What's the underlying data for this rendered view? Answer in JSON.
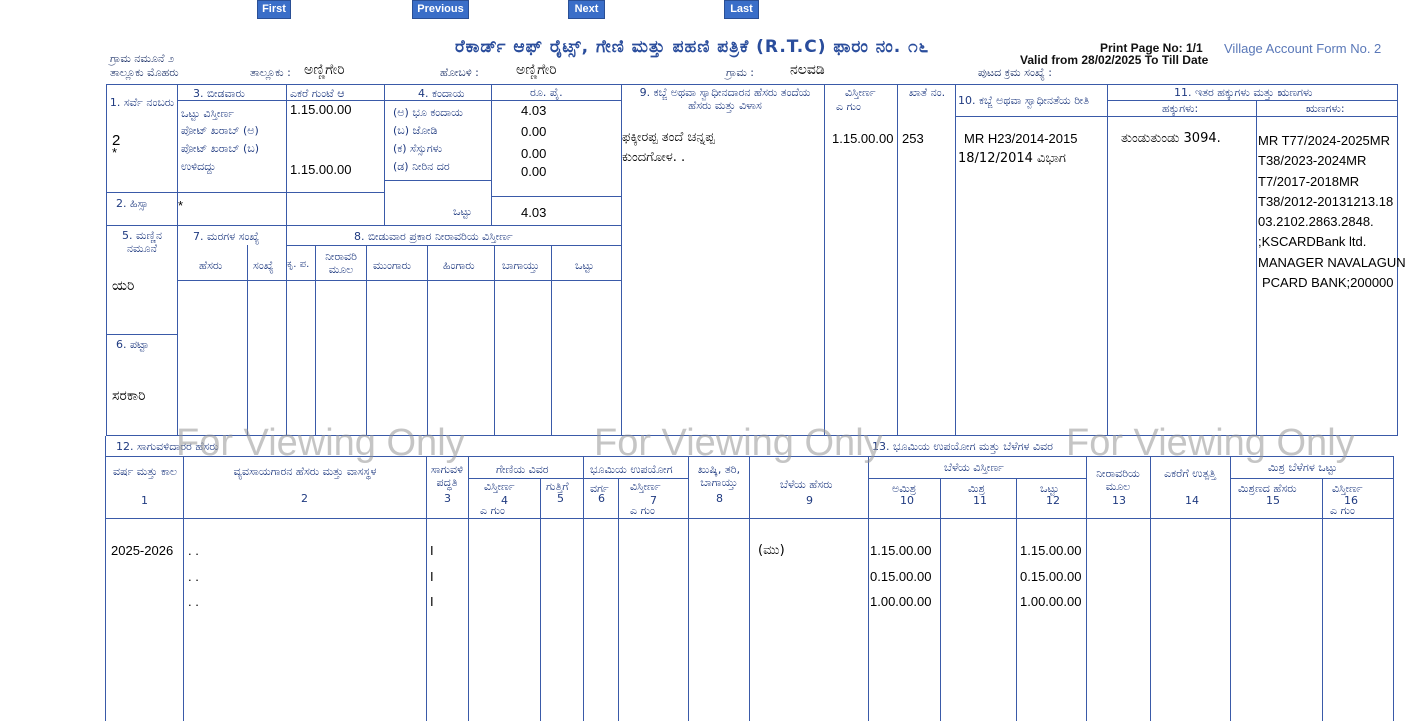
{
  "nav": {
    "first": "First",
    "previous": "Previous",
    "next": "Next",
    "last": "Last"
  },
  "header": {
    "title": "ರೆಕಾರ್ಡ್ ಆಫ್ ರೈಟ್ಸ್, ಗೇಣಿ ಮತ್ತು ಪಹಣಿ ಪತ್ರಿಕೆ (R.T.C) ಫಾರಂ ನಂ. ೧೬",
    "print_page": "Print Page No: 1/1",
    "form_name": "Village Account Form No. 2",
    "valid_from": "Valid from 28/02/2025 To Till Date",
    "form_label": "ಗ್ರಾಮ ನಮೂನೆ ೨",
    "taluk_seal_label": "ತಾಲ್ಲೂಕು ಮೊಹರು",
    "taluk_label": "ತಾಲ್ಲೂಕು :",
    "taluk": "ಅಣ್ಣಿಗೇರಿ",
    "hobli_label": "ಹೋಬಳಿ :",
    "hobli": "ಅಣ್ಣಿಗೇರಿ",
    "village_label": "ಗ್ರಾಮ :",
    "village": "ನಲವಡಿ",
    "page_serial_label": "ಪುಟದ ಕ್ರಮ ಸಂಖ್ಯೆ :"
  },
  "survey": {
    "survey_no_label": "1. ಸರ್ವೆ ನಂಬರು",
    "survey_no": "2",
    "star": "*",
    "hissa_label": "2. ಹಿಸ್ಸಾ",
    "hissa": "*",
    "cultivated_label": "3. ಬೀಡವಾರು",
    "ekare_header": "ಎಕರೆ   ಗುಂಟೆ   ಆ",
    "total_area_label": "ಒಟ್ಟು ವಿಸ್ತೀರ್ಣ",
    "pot_a_label": "ಪೋಟ್ ಖರಾಬ್ (ಅ)",
    "pot_b_label": "ಪೋಟ್ ಖರಾಬ್ (ಬ)",
    "remaining_label": "ಉಳಿದದ್ದು",
    "total_area": "1.15.00.00",
    "remaining": "1.15.00.00",
    "revenue_label": "4. ಕಂದಾಯ",
    "rs_label": "ರೂ.          ಪೈ.",
    "land_rev_label": "(ಅ) ಭೂ ಕಂದಾಯ",
    "jodi_label": "(ಬ) ಜೋಡಿ",
    "cess_label": "(ಕ) ಸೆಸ್ಸುಗಳು",
    "water_label": "(ಡ) ನೀರಿನ ದರ",
    "land_rev": "4.03",
    "jodi": "0.00",
    "cess": "0.00",
    "water": "0.00",
    "total_label": "ಒಟ್ಟು",
    "total": "4.03",
    "soil_label": "5. ಮಣ್ಣಿನ ನಮೂನೆ",
    "soil": "ಯರಿ",
    "tree_label": "7. ಮರಗಳ ಸಂಖ್ಯೆ",
    "tree_name": "ಹೆಸರು",
    "tree_count": "ಸಂಖ್ಯೆ",
    "kp": "ಕೃ. ಪ.",
    "irrig_label": "8. ಬೀಡುವಾರ ಪ್ರಕಾರ ನೀರಾವರಿಯ ವಿಸ್ತೀರ್ಣ",
    "irrig_source": "ನೀರಾವರಿ ಮೂಲ",
    "mungaru": "ಮುಂಗಾರು",
    "hingaru": "ಹಿಂಗಾರು",
    "bagayat": "ಬಾಗಾಯ್ತು",
    "ottu": "ಒಟ್ಟು",
    "patta_label": "6. ಪಟ್ಟಾ",
    "patta": "ಸರಕಾರಿ"
  },
  "owner": {
    "owner_header": "9. ಕಬ್ಜೆ ಅಥವಾ ಸ್ವಾಧೀನದಾರನ ಹೆಸರು ತಂದೆಯ ಹೆಸರು ಮತ್ತು ವಿಳಾಸ",
    "area_header": "ವಿಸ್ತೀರ್ಣ",
    "area_units": "ಎ         ಗುಂ",
    "khata_header": "ಖಾತೆ ನಂ.",
    "mutation_header": "10. ಕಬ್ಜೆ ಅಥವಾ ಸ್ವಾಧೀನತೆಯ ರೀತಿ",
    "rights_header": "11. ಇತರ ಹಕ್ಕುಗಳು ಮತ್ತು ಋಣಗಳು",
    "rights_sub": "ಹಕ್ಕುಗಳು:",
    "liabilities_sub": "ಋಣಗಳು:",
    "owner_line1": "ಫಕ್ಕೀರಪ್ಪ ತಂದೆ ಚನ್ನಪ್ಪ",
    "owner_line2": "ಕುಂದಗೋಳ. .",
    "owner_area": "1.15.00.00",
    "khata": "253",
    "mutation_line1": "MR H23/2014-2015",
    "mutation_line2": "18/12/2014 ವಿಭಾಗ",
    "rights": "ತುಂಡುತುಂಡು 3094.",
    "liabilities": [
      "MR T77/2024-2025MR",
      "T38/2023-2024MR",
      "T7/2017-2018MR",
      "T38/2012-20131213.18",
      "03.2102.2863.2848.",
      ";KSCARDBank ltd.",
      "MANAGER NAVALAGUN",
      "PCARD BANK;200000"
    ]
  },
  "crop": {
    "section12": "12. ಸಾಗುವಳಿದಾರರ ಹೆಸರು",
    "section13": "13. ಭೂಮಿಯ ಉಪಯೋಗ ಮತ್ತು ಬೆಳೆಗಳ ವಿವರ",
    "col_year": "ವರ್ಷ ಮತ್ತು ಕಾಲ",
    "col_cultivator": "ವ್ಯವಸಾಯಗಾರನ ಹೆಸರು ಮತ್ತು ವಾಸಸ್ಥಳ",
    "col_method": "ಸಾಗುವಳಿ ಪದ್ಧತಿ",
    "col_tenancy": "ಗೇಣಿಯ ವಿವರ",
    "col_t_area": "ವಿಸ್ತೀರ್ಣ",
    "col_rent": "ಗುತ್ತಿಗೆ",
    "col_landuse": "ಭೂಮಿಯ ಉಪಯೋಗ",
    "col_class": "ವರ್ಗ",
    "col_lu_area": "ವಿಸ್ತೀರ್ಣ",
    "col_crop_type": "ಖುಷ್ಕಿ, ತರಿ, ಬಾಗಾಯ್ತು",
    "col_crop_name": "ಬೆಳೆಯ ಹೆಸರು",
    "col_crop_area": "ಬೆಳೆಯ ವಿಸ್ತೀರ್ಣ",
    "col_pure": "ಅಮಿಶ್ರ",
    "col_mixed": "ಮಿಶ್ರ",
    "col_total": "ಒಟ್ಟು",
    "col_irrig": "ನೀರಾವರಿಯ ಮೂಲ",
    "col_yield": "ಎಕರೆಗೆ ಉತ್ಪತ್ತಿ",
    "col_mixed_total": "ಮಿಶ್ರ ಬೆಳೆಗಳ ಒಟ್ಟು",
    "col_mixed_name": "ಮಿಶ್ರಣದ ಹೆಸರು",
    "col_mixed_area": "ವಿಸ್ತೀರ್ಣ",
    "n1": "1",
    "n2": "2",
    "n3": "3",
    "n4": "4",
    "n5": "5",
    "n6": "6",
    "n7": "7",
    "n8": "8",
    "n9": "9",
    "n10": "10",
    "n11": "11",
    "n12": "12",
    "n13": "13",
    "n14": "14",
    "n15": "15",
    "n16": "16",
    "units_eg": "ಎ       ಗುಂ",
    "year": "2025-2026",
    "rows": [
      {
        "cultivator": ". .",
        "method": "I",
        "crop": "(ಮು)",
        "pure": "1.15.00.00",
        "total": "1.15.00.00"
      },
      {
        "cultivator": ". .",
        "method": "I",
        "crop": "",
        "pure": "0.15.00.00",
        "total": "0.15.00.00"
      },
      {
        "cultivator": ". .",
        "method": "I",
        "crop": "",
        "pure": "1.00.00.00",
        "total": "1.00.00.00"
      }
    ]
  },
  "watermark": "For Viewing Only"
}
